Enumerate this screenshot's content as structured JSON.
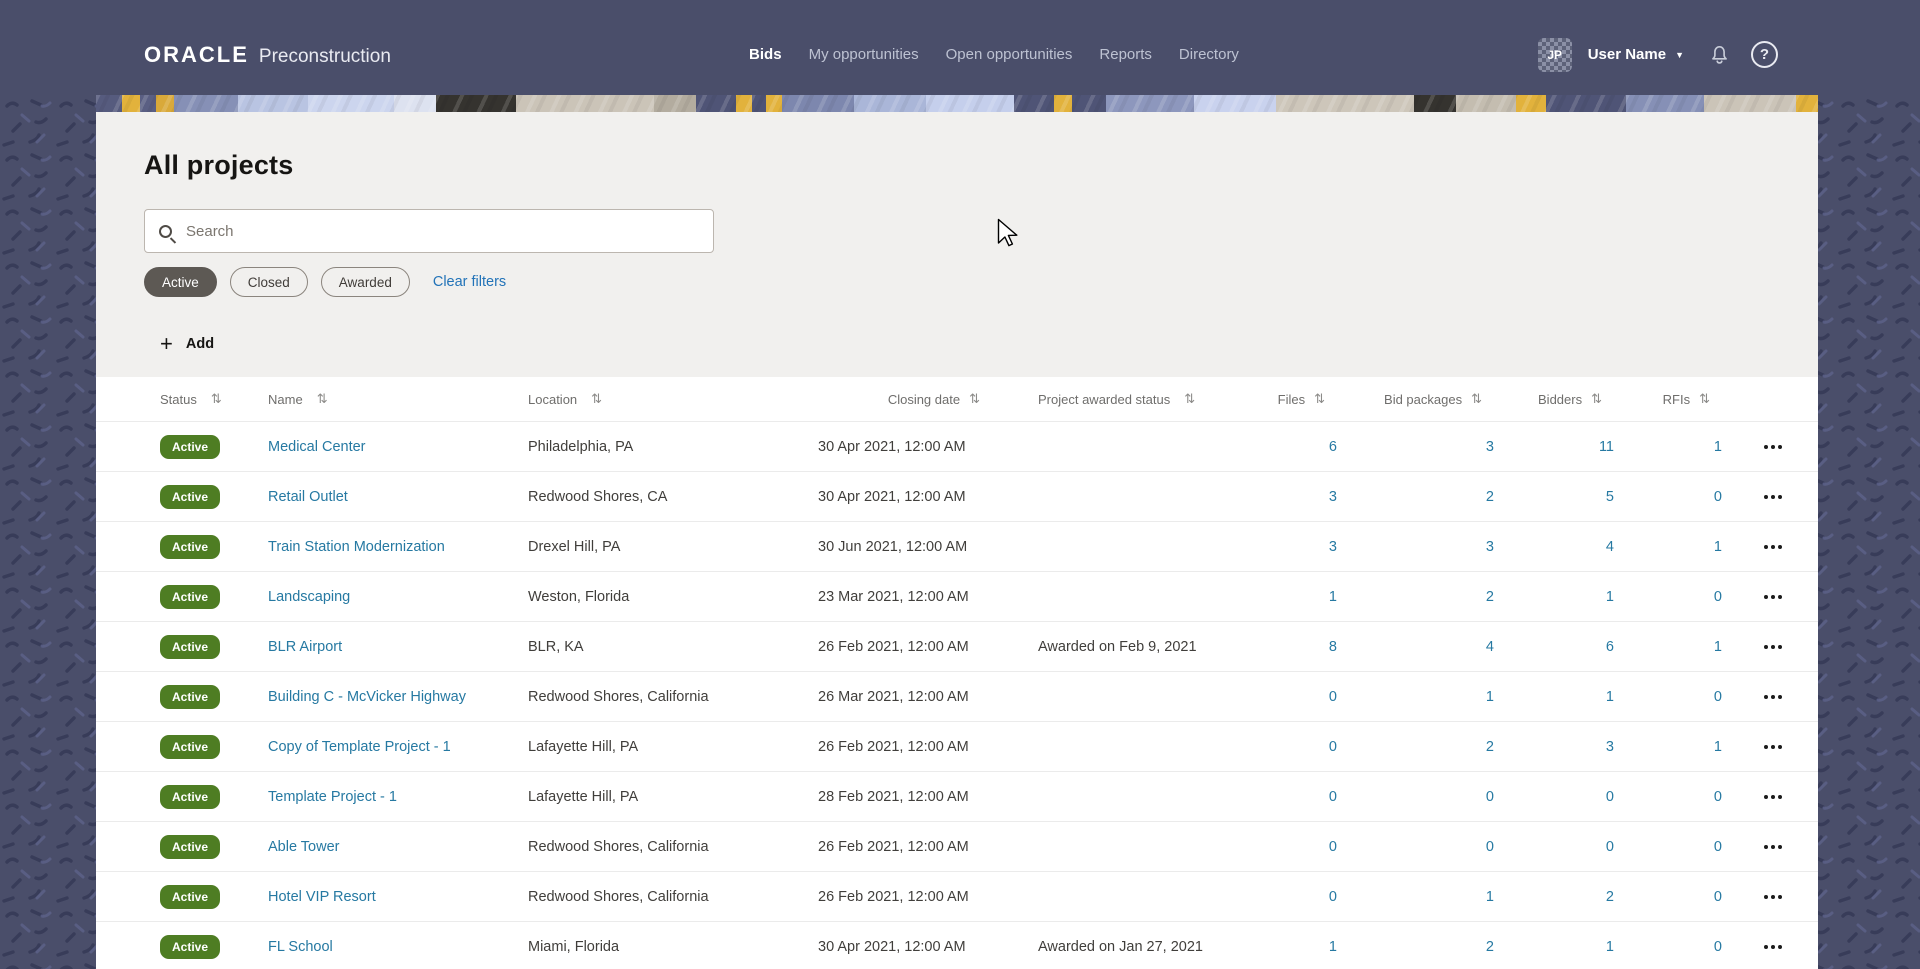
{
  "colors": {
    "header_bg": "#4a4e6a",
    "panel_bg": "#f1f0ee",
    "badge_green": "#4e7d23",
    "link_teal": "#2679a2",
    "clear_filters_link": "#2273b8",
    "chip_selected_bg": "#5d5954",
    "banner_gold": "#e2b23c"
  },
  "icons": {
    "sort": "⇅",
    "caret_down": "▼",
    "plus": "+",
    "question": "?"
  },
  "header": {
    "logo_primary": "ORACLE",
    "logo_product": "Preconstruction",
    "nav": [
      {
        "label": "Bids",
        "active": true
      },
      {
        "label": "My opportunities",
        "active": false
      },
      {
        "label": "Open opportunities",
        "active": false
      },
      {
        "label": "Reports",
        "active": false
      },
      {
        "label": "Directory",
        "active": false
      }
    ],
    "user": {
      "initials": "JP",
      "name": "User Name"
    }
  },
  "page": {
    "title": "All projects",
    "search": {
      "placeholder": "Search",
      "value": ""
    },
    "filter_chips": [
      {
        "label": "Active",
        "selected": true
      },
      {
        "label": "Closed",
        "selected": false
      },
      {
        "label": "Awarded",
        "selected": false
      }
    ],
    "clear_filters_label": "Clear filters",
    "add_button_label": "Add"
  },
  "table": {
    "columns": [
      "Status",
      "Name",
      "Location",
      "Closing date",
      "Project awarded status",
      "Files",
      "Bid packages",
      "Bidders",
      "RFIs"
    ],
    "rows": [
      {
        "status": "Active",
        "name": "Medical Center",
        "location": "Philadelphia, PA",
        "closing_date": "30 Apr 2021, 12:00 AM",
        "awarded_status": "",
        "files": "6",
        "bid_packages": "3",
        "bidders": "11",
        "rfis": "1"
      },
      {
        "status": "Active",
        "name": "Retail Outlet",
        "location": "Redwood Shores, CA",
        "closing_date": "30 Apr 2021, 12:00 AM",
        "awarded_status": "",
        "files": "3",
        "bid_packages": "2",
        "bidders": "5",
        "rfis": "0"
      },
      {
        "status": "Active",
        "name": "Train Station Modernization",
        "location": "Drexel Hill, PA",
        "closing_date": "30 Jun 2021, 12:00 AM",
        "awarded_status": "",
        "files": "3",
        "bid_packages": "3",
        "bidders": "4",
        "rfis": "1"
      },
      {
        "status": "Active",
        "name": "Landscaping",
        "location": "Weston, Florida",
        "closing_date": "23 Mar 2021, 12:00 AM",
        "awarded_status": "",
        "files": "1",
        "bid_packages": "2",
        "bidders": "1",
        "rfis": "0"
      },
      {
        "status": "Active",
        "name": "BLR Airport",
        "location": "BLR, KA",
        "closing_date": "26 Feb 2021, 12:00 AM",
        "awarded_status": "Awarded on Feb 9, 2021",
        "files": "8",
        "bid_packages": "4",
        "bidders": "6",
        "rfis": "1"
      },
      {
        "status": "Active",
        "name": "Building C - McVicker Highway",
        "location": "Redwood Shores, California",
        "closing_date": "26 Mar 2021, 12:00 AM",
        "awarded_status": "",
        "files": "0",
        "bid_packages": "1",
        "bidders": "1",
        "rfis": "0"
      },
      {
        "status": "Active",
        "name": "Copy of Template Project - 1",
        "location": "Lafayette Hill, PA",
        "closing_date": "26 Feb 2021, 12:00 AM",
        "awarded_status": "",
        "files": "0",
        "bid_packages": "2",
        "bidders": "3",
        "rfis": "1"
      },
      {
        "status": "Active",
        "name": "Template Project - 1",
        "location": "Lafayette Hill, PA",
        "closing_date": "28 Feb 2021, 12:00 AM",
        "awarded_status": "",
        "files": "0",
        "bid_packages": "0",
        "bidders": "0",
        "rfis": "0"
      },
      {
        "status": "Active",
        "name": "Able Tower",
        "location": "Redwood Shores, California",
        "closing_date": "26 Feb 2021, 12:00 AM",
        "awarded_status": "",
        "files": "0",
        "bid_packages": "0",
        "bidders": "0",
        "rfis": "0"
      },
      {
        "status": "Active",
        "name": "Hotel VIP Resort",
        "location": "Redwood Shores, California",
        "closing_date": "26 Feb 2021, 12:00 AM",
        "awarded_status": "",
        "files": "0",
        "bid_packages": "1",
        "bidders": "2",
        "rfis": "0"
      },
      {
        "status": "Active",
        "name": "FL School",
        "location": "Miami, Florida",
        "closing_date": "30 Apr 2021, 12:00 AM",
        "awarded_status": "Awarded on Jan 27, 2021",
        "files": "1",
        "bid_packages": "2",
        "bidders": "1",
        "rfis": "0"
      }
    ]
  }
}
